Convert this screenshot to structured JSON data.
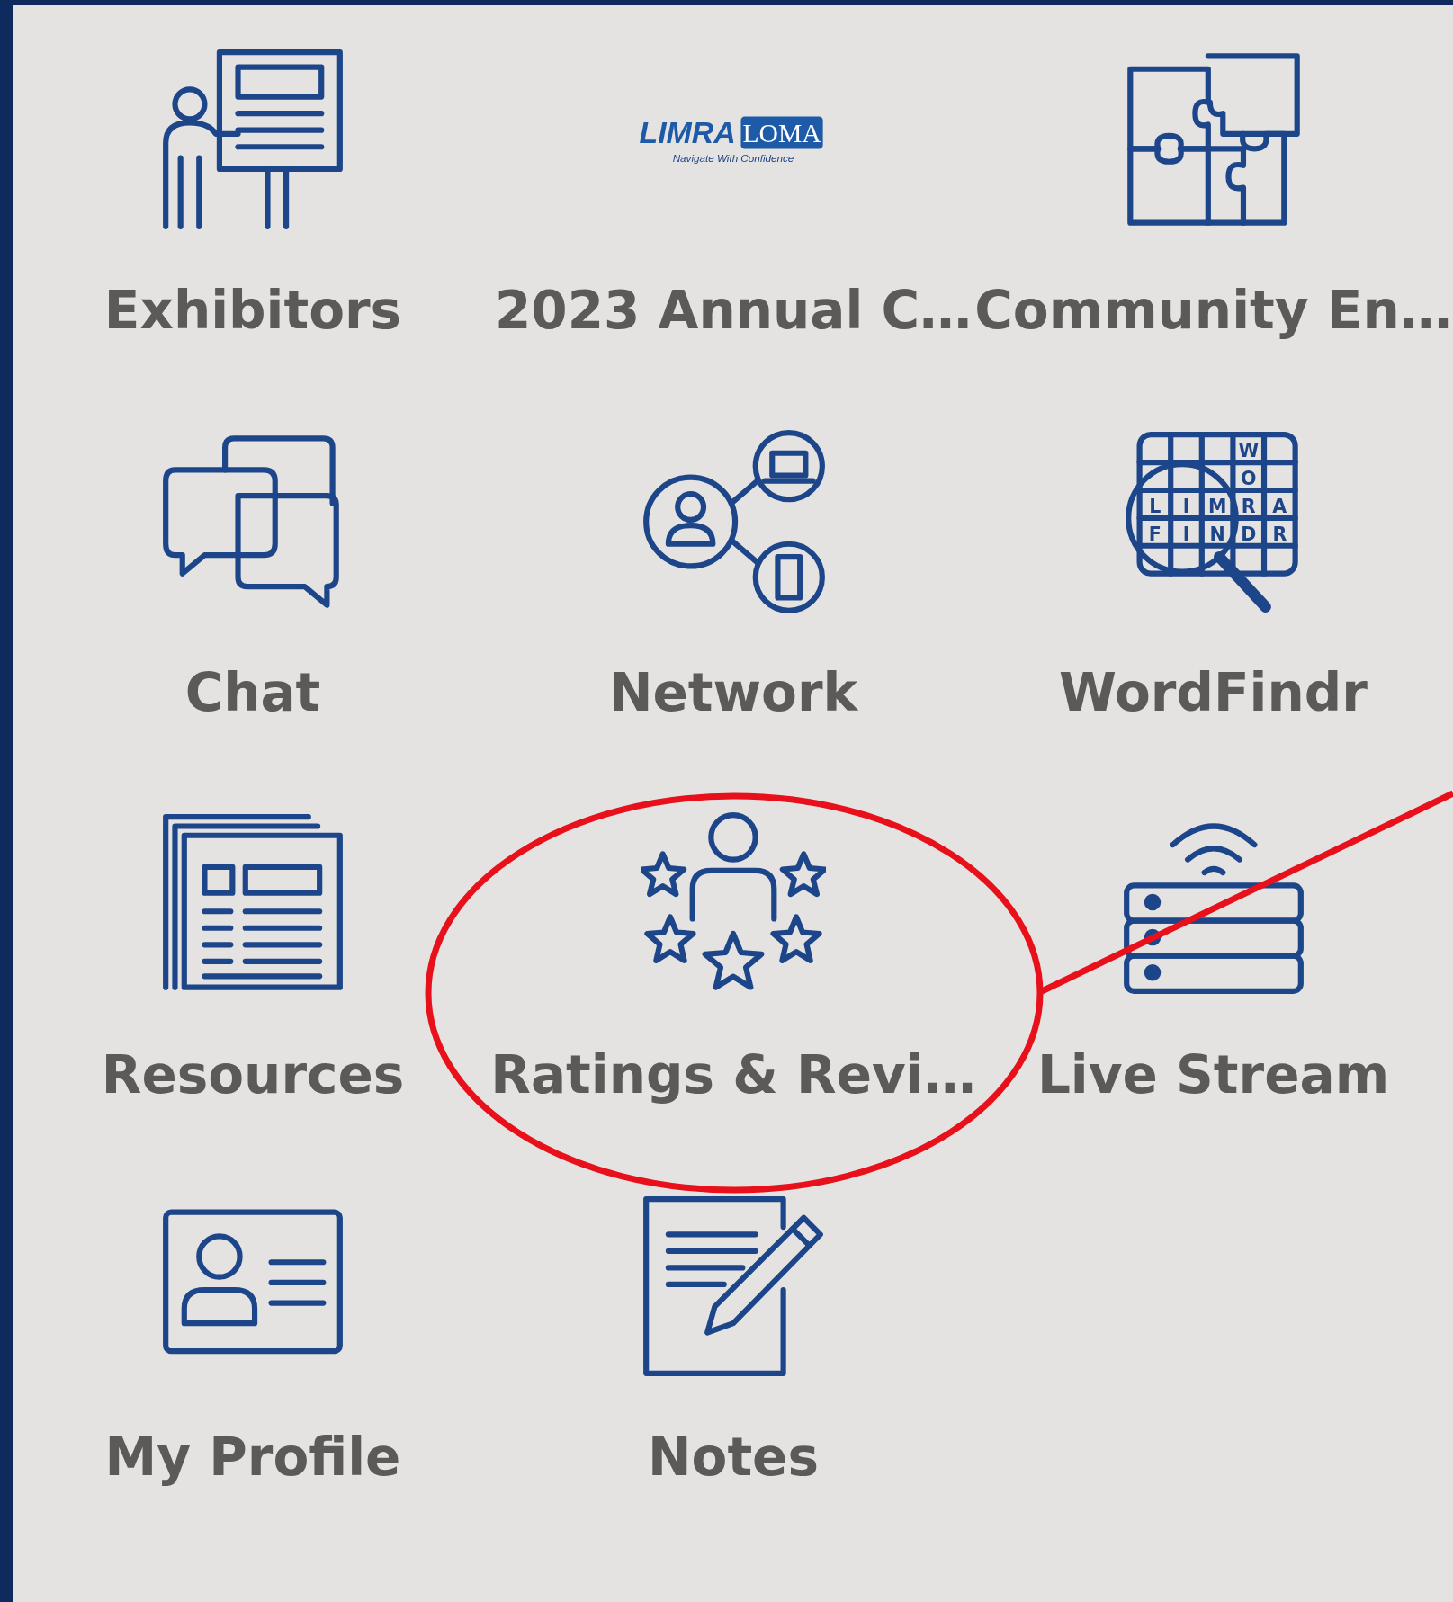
{
  "tiles": [
    {
      "label": "Exhibitors"
    },
    {
      "label": "2023 Annual C…",
      "logo": {
        "left": "LIMRA",
        "right": "LOMA",
        "tagline": "Navigate With Confidence"
      }
    },
    {
      "label": "Community En…"
    },
    {
      "label": "Chat"
    },
    {
      "label": "Network"
    },
    {
      "label": "WordFindr",
      "grid": [
        "W",
        "O",
        "L",
        "I",
        "M",
        "R",
        "A",
        "F",
        "I",
        "N",
        "D",
        "R"
      ]
    },
    {
      "label": "Resources"
    },
    {
      "label": "Ratings & Revi…"
    },
    {
      "label": "Live Stream"
    },
    {
      "label": "My Profile"
    },
    {
      "label": "Notes"
    }
  ],
  "annotation": {
    "kind": "circle"
  }
}
